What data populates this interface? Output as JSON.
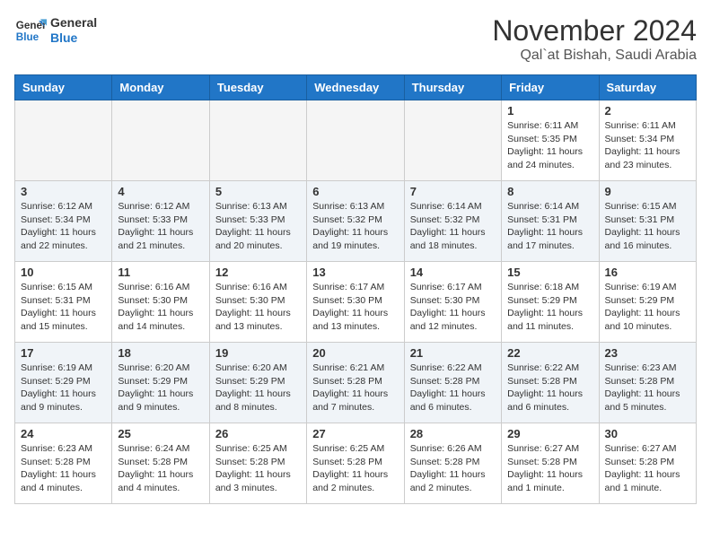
{
  "logo": {
    "line1": "General",
    "line2": "Blue"
  },
  "title": "November 2024",
  "location": "Qal`at Bishah, Saudi Arabia",
  "weekdays": [
    "Sunday",
    "Monday",
    "Tuesday",
    "Wednesday",
    "Thursday",
    "Friday",
    "Saturday"
  ],
  "weeks": [
    [
      {
        "day": "",
        "info": ""
      },
      {
        "day": "",
        "info": ""
      },
      {
        "day": "",
        "info": ""
      },
      {
        "day": "",
        "info": ""
      },
      {
        "day": "",
        "info": ""
      },
      {
        "day": "1",
        "info": "Sunrise: 6:11 AM\nSunset: 5:35 PM\nDaylight: 11 hours\nand 24 minutes."
      },
      {
        "day": "2",
        "info": "Sunrise: 6:11 AM\nSunset: 5:34 PM\nDaylight: 11 hours\nand 23 minutes."
      }
    ],
    [
      {
        "day": "3",
        "info": "Sunrise: 6:12 AM\nSunset: 5:34 PM\nDaylight: 11 hours\nand 22 minutes."
      },
      {
        "day": "4",
        "info": "Sunrise: 6:12 AM\nSunset: 5:33 PM\nDaylight: 11 hours\nand 21 minutes."
      },
      {
        "day": "5",
        "info": "Sunrise: 6:13 AM\nSunset: 5:33 PM\nDaylight: 11 hours\nand 20 minutes."
      },
      {
        "day": "6",
        "info": "Sunrise: 6:13 AM\nSunset: 5:32 PM\nDaylight: 11 hours\nand 19 minutes."
      },
      {
        "day": "7",
        "info": "Sunrise: 6:14 AM\nSunset: 5:32 PM\nDaylight: 11 hours\nand 18 minutes."
      },
      {
        "day": "8",
        "info": "Sunrise: 6:14 AM\nSunset: 5:31 PM\nDaylight: 11 hours\nand 17 minutes."
      },
      {
        "day": "9",
        "info": "Sunrise: 6:15 AM\nSunset: 5:31 PM\nDaylight: 11 hours\nand 16 minutes."
      }
    ],
    [
      {
        "day": "10",
        "info": "Sunrise: 6:15 AM\nSunset: 5:31 PM\nDaylight: 11 hours\nand 15 minutes."
      },
      {
        "day": "11",
        "info": "Sunrise: 6:16 AM\nSunset: 5:30 PM\nDaylight: 11 hours\nand 14 minutes."
      },
      {
        "day": "12",
        "info": "Sunrise: 6:16 AM\nSunset: 5:30 PM\nDaylight: 11 hours\nand 13 minutes."
      },
      {
        "day": "13",
        "info": "Sunrise: 6:17 AM\nSunset: 5:30 PM\nDaylight: 11 hours\nand 13 minutes."
      },
      {
        "day": "14",
        "info": "Sunrise: 6:17 AM\nSunset: 5:30 PM\nDaylight: 11 hours\nand 12 minutes."
      },
      {
        "day": "15",
        "info": "Sunrise: 6:18 AM\nSunset: 5:29 PM\nDaylight: 11 hours\nand 11 minutes."
      },
      {
        "day": "16",
        "info": "Sunrise: 6:19 AM\nSunset: 5:29 PM\nDaylight: 11 hours\nand 10 minutes."
      }
    ],
    [
      {
        "day": "17",
        "info": "Sunrise: 6:19 AM\nSunset: 5:29 PM\nDaylight: 11 hours\nand 9 minutes."
      },
      {
        "day": "18",
        "info": "Sunrise: 6:20 AM\nSunset: 5:29 PM\nDaylight: 11 hours\nand 9 minutes."
      },
      {
        "day": "19",
        "info": "Sunrise: 6:20 AM\nSunset: 5:29 PM\nDaylight: 11 hours\nand 8 minutes."
      },
      {
        "day": "20",
        "info": "Sunrise: 6:21 AM\nSunset: 5:28 PM\nDaylight: 11 hours\nand 7 minutes."
      },
      {
        "day": "21",
        "info": "Sunrise: 6:22 AM\nSunset: 5:28 PM\nDaylight: 11 hours\nand 6 minutes."
      },
      {
        "day": "22",
        "info": "Sunrise: 6:22 AM\nSunset: 5:28 PM\nDaylight: 11 hours\nand 6 minutes."
      },
      {
        "day": "23",
        "info": "Sunrise: 6:23 AM\nSunset: 5:28 PM\nDaylight: 11 hours\nand 5 minutes."
      }
    ],
    [
      {
        "day": "24",
        "info": "Sunrise: 6:23 AM\nSunset: 5:28 PM\nDaylight: 11 hours\nand 4 minutes."
      },
      {
        "day": "25",
        "info": "Sunrise: 6:24 AM\nSunset: 5:28 PM\nDaylight: 11 hours\nand 4 minutes."
      },
      {
        "day": "26",
        "info": "Sunrise: 6:25 AM\nSunset: 5:28 PM\nDaylight: 11 hours\nand 3 minutes."
      },
      {
        "day": "27",
        "info": "Sunrise: 6:25 AM\nSunset: 5:28 PM\nDaylight: 11 hours\nand 2 minutes."
      },
      {
        "day": "28",
        "info": "Sunrise: 6:26 AM\nSunset: 5:28 PM\nDaylight: 11 hours\nand 2 minutes."
      },
      {
        "day": "29",
        "info": "Sunrise: 6:27 AM\nSunset: 5:28 PM\nDaylight: 11 hours\nand 1 minute."
      },
      {
        "day": "30",
        "info": "Sunrise: 6:27 AM\nSunset: 5:28 PM\nDaylight: 11 hours\nand 1 minute."
      }
    ]
  ]
}
